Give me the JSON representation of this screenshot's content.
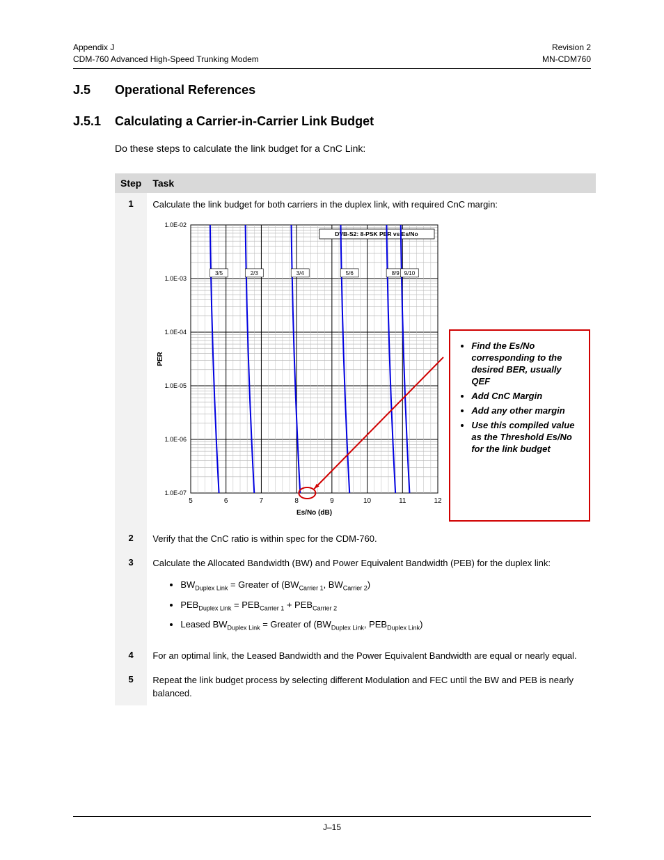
{
  "header": {
    "left_top": "Appendix J",
    "left_bottom": "CDM-760 Advanced High-Speed Trunking Modem",
    "right_top": "Revision 2",
    "right_bottom": "MN-CDM760"
  },
  "sections": {
    "j5_num": "J.5",
    "j5_title": "Operational References",
    "j51_num": "J.5.1",
    "j51_title": "Calculating a Carrier-in-Carrier Link Budget"
  },
  "intro": "Do these steps to calculate the link budget for a CnC Link:",
  "table": {
    "head_step": "Step",
    "head_task": "Task",
    "rows": [
      {
        "num": "1",
        "text": "Calculate the link budget for both carriers in the duplex link, with required CnC margin:"
      },
      {
        "num": "2",
        "text": "Verify that the CnC ratio is within spec for the CDM-760."
      },
      {
        "num": "3",
        "text": "Calculate the Allocated Bandwidth (BW) and Power Equivalent Bandwidth (PEB) for the duplex link:",
        "formulas": {
          "bw_prefix": "BW",
          "bw_sub": "Duplex Link",
          "bw_rhs_a": " = Greater of (BW",
          "bw_rhs_a_sub": "Carrier 1",
          "bw_rhs_b": ", BW",
          "bw_rhs_b_sub": "Carrier 2",
          "bw_rhs_c": ")",
          "peb_prefix": "PEB",
          "peb_sub": "Duplex Link",
          "peb_rhs_a": " = PEB",
          "peb_rhs_a_sub": "Carrier 1",
          "peb_rhs_b": " + PEB",
          "peb_rhs_b_sub": "Carrier 2",
          "lbw_prefix": "Leased BW",
          "lbw_sub": "Duplex Link",
          "lbw_rhs_a": " = Greater of (BW",
          "lbw_rhs_a_sub": "Duplex Link",
          "lbw_rhs_b": ", PEB",
          "lbw_rhs_b_sub": "Duplex Link",
          "lbw_rhs_c": ")"
        }
      },
      {
        "num": "4",
        "text": "For an optimal link, the Leased Bandwidth and the Power Equivalent Bandwidth are equal or nearly equal."
      },
      {
        "num": "5",
        "text": "Repeat the link budget process by selecting different Modulation and FEC until the BW and PEB is nearly balanced."
      }
    ]
  },
  "callout": {
    "item1": "Find the Es/No corresponding to the desired BER, usually QEF",
    "item2": "Add CnC Margin",
    "item3": "Add any other margin",
    "item4": "Use this compiled value as the Threshold Es/No for the link budget"
  },
  "footer": "J–15",
  "chart_data": {
    "type": "line",
    "title": "DVB-S2: 8-PSK PER vs Es/No",
    "xlabel": "Es/No (dB)",
    "ylabel": "PER",
    "xlim": [
      5,
      12
    ],
    "ylim_log": [
      1e-07,
      0.01
    ],
    "y_ticks": [
      "1.0E-02",
      "1.0E-03",
      "1.0E-04",
      "1.0E-05",
      "1.0E-06",
      "1.0E-07"
    ],
    "x_ticks": [
      5,
      6,
      7,
      8,
      9,
      10,
      11,
      12
    ],
    "series": [
      {
        "name": "3/5",
        "x_at_label": 5.8,
        "xs": [
          5.55,
          5.8
        ],
        "ys": [
          0.01,
          1e-07
        ]
      },
      {
        "name": "2/3",
        "x_at_label": 6.8,
        "xs": [
          6.55,
          6.8
        ],
        "ys": [
          0.01,
          1e-07
        ]
      },
      {
        "name": "3/4",
        "x_at_label": 8.1,
        "xs": [
          7.85,
          8.1
        ],
        "ys": [
          0.01,
          1e-07
        ]
      },
      {
        "name": "5/6",
        "x_at_label": 9.5,
        "xs": [
          9.25,
          9.5
        ],
        "ys": [
          0.01,
          1e-07
        ]
      },
      {
        "name": "8/9",
        "x_at_label": 10.8,
        "xs": [
          10.55,
          10.8
        ],
        "ys": [
          0.01,
          1e-07
        ]
      },
      {
        "name": "9/10",
        "x_at_label": 11.2,
        "xs": [
          10.95,
          11.2
        ],
        "ys": [
          0.01,
          1e-07
        ]
      }
    ],
    "highlight_point": {
      "x": 8.3,
      "y": 1e-07,
      "label": "threshold Es/No circled"
    }
  }
}
